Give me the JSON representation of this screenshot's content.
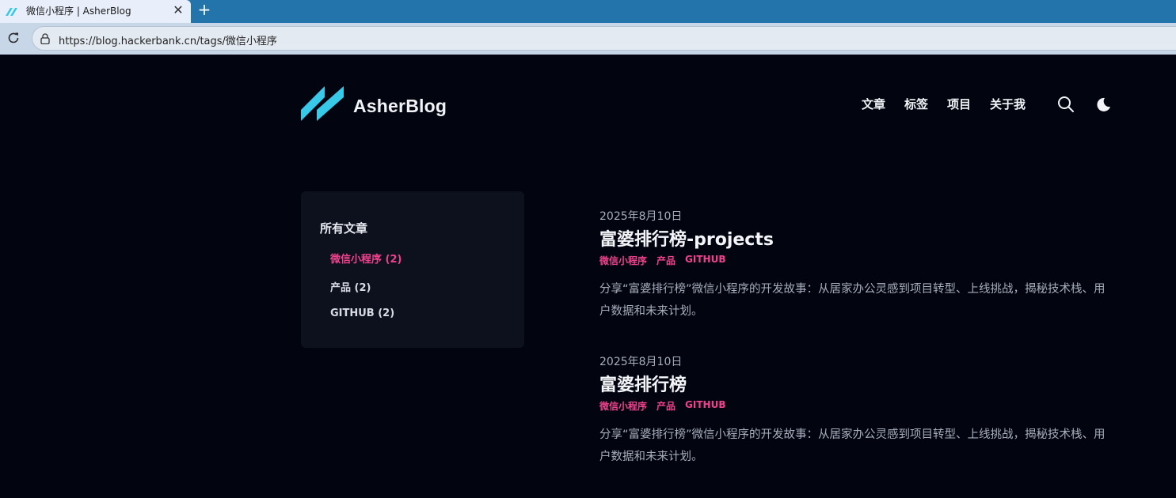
{
  "browser": {
    "tab_title": "微信小程序 | AsherBlog",
    "tab_close": "✕",
    "new_tab": "+",
    "url": "https://blog.hackerbank.cn/tags/微信小程序"
  },
  "header": {
    "brand": "AsherBlog",
    "nav": [
      "文章",
      "标签",
      "项目",
      "关于我"
    ],
    "icons": [
      "search-icon",
      "moon-icon"
    ]
  },
  "sidebar": {
    "title": "所有文章",
    "tags": [
      {
        "label": "微信小程序 (2)",
        "active": true
      },
      {
        "label": "产品 (2)",
        "active": false
      },
      {
        "label": "GITHUB (2)",
        "active": false
      }
    ]
  },
  "posts": [
    {
      "date": "2025年8月10日",
      "title": "富婆排行榜-projects",
      "tags": [
        "微信小程序",
        "产品",
        "GITHUB"
      ],
      "summary": "分享“富婆排行榜”微信小程序的开发故事：从居家办公灵感到项目转型、上线挑战，揭秘技术栈、用户数据和未来计划。"
    },
    {
      "date": "2025年8月10日",
      "title": "富婆排行榜",
      "tags": [
        "微信小程序",
        "产品",
        "GITHUB"
      ],
      "summary": "分享“富婆排行榜”微信小程序的开发故事：从居家办公灵感到项目转型、上线挑战，揭秘技术栈、用户数据和未来计划。"
    }
  ],
  "colors": {
    "background": "#02050f",
    "card": "#0d111e",
    "accent": "#f0418f",
    "logo": "#38c8e8"
  }
}
